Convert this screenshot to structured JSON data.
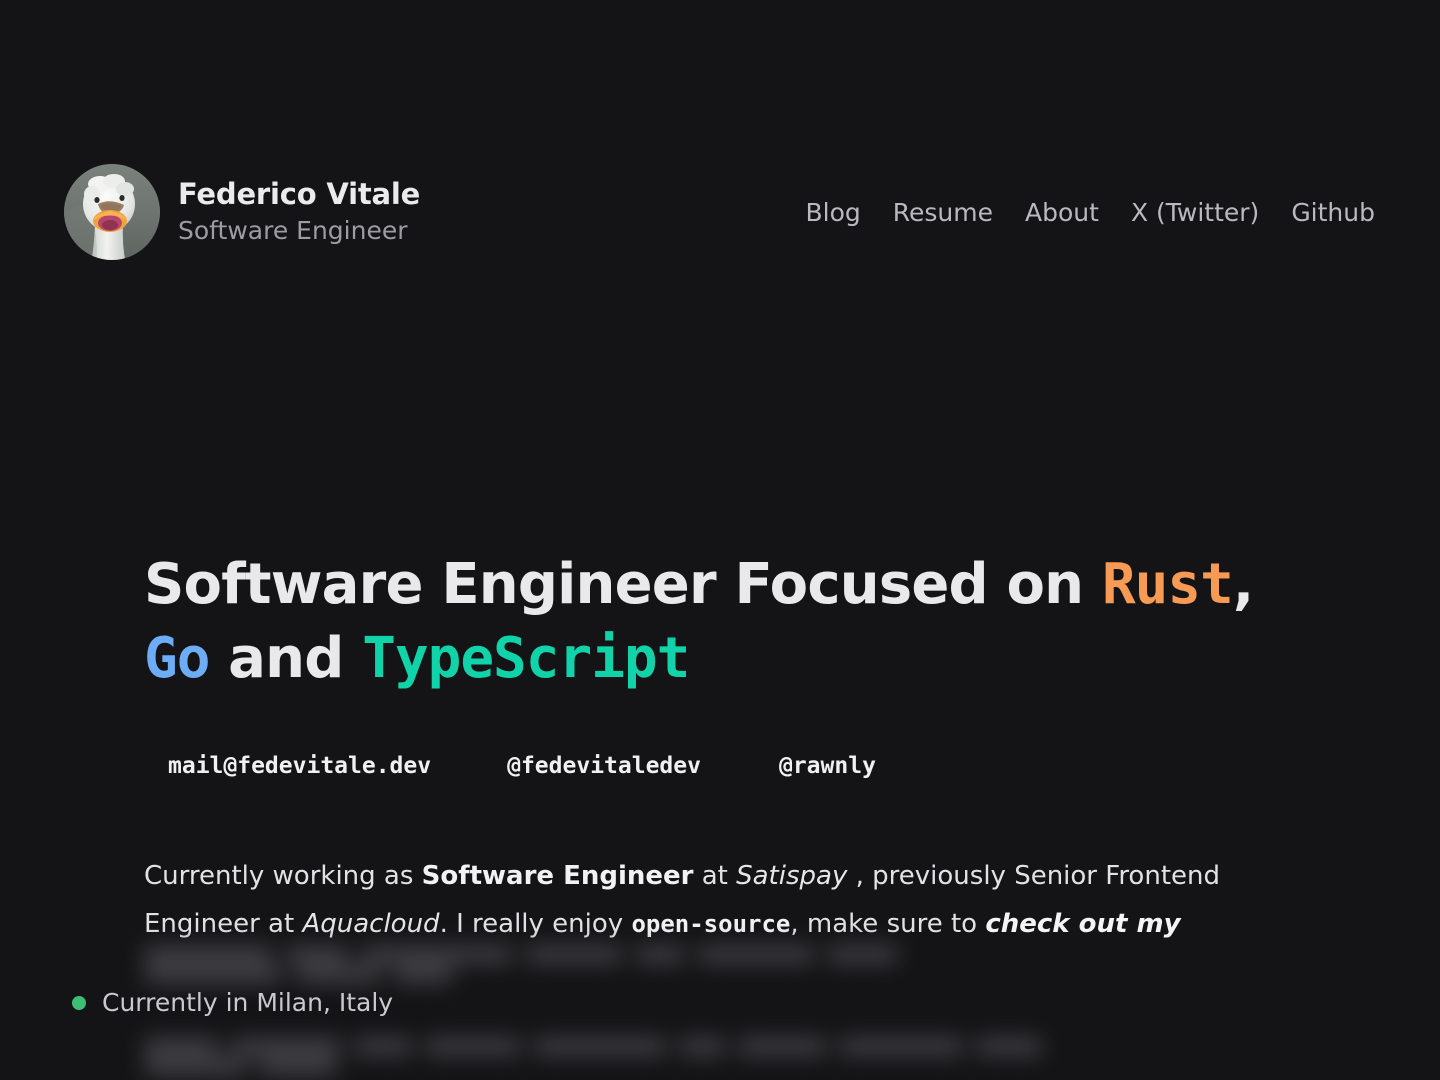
{
  "page": {
    "background_color": "#141416",
    "text_color": "#e9e9eb"
  },
  "header": {
    "avatar": {
      "icon": "goose-avatar",
      "alt": "Goose photo avatar",
      "background_color": "#6e7470"
    },
    "name": "Federico Vitale",
    "role": "Software Engineer",
    "nav": [
      {
        "label": "Blog",
        "name": "nav-link-blog"
      },
      {
        "label": "Resume",
        "name": "nav-link-resume"
      },
      {
        "label": "About",
        "name": "nav-link-about"
      },
      {
        "label": "X (Twitter)",
        "name": "nav-link-x-twitter"
      },
      {
        "label": "Github",
        "name": "nav-link-github"
      }
    ]
  },
  "hero": {
    "title_part_1": "Software Engineer Focused on ",
    "title_rust": "Rust",
    "title_comma": ", ",
    "title_go": "Go",
    "title_and": " and ",
    "title_typescript": "TypeScript",
    "colors": {
      "rust": "#f79a53",
      "go": "#6cadf5",
      "typescript": "#11d3aa"
    }
  },
  "contacts": [
    {
      "label": "mail@fedevitale.dev",
      "name": "contact-email"
    },
    {
      "label": "@fedevitaledev",
      "name": "contact-twitter-handle"
    },
    {
      "label": "@rawnly",
      "name": "contact-github-handle"
    }
  ],
  "bio": {
    "seg_1": "Currently working as ",
    "seg_2_bold": "Software Engineer",
    "seg_3": " at ",
    "seg_4_italic": "Satispay",
    "seg_5": " , previously Senior Frontend Engineer at ",
    "seg_6_italic": "Aquacloud",
    "seg_7": ". I really enjoy ",
    "seg_8_mono": "open-source",
    "seg_9": ", make sure to ",
    "seg_10_bold_italic": "check out my"
  },
  "status": {
    "dot_color": "#3dbd75",
    "label": "Currently in Milan, Italy"
  },
  "blurred_content": {
    "note": "obscured text lines behind status bar",
    "line_1_runs": [
      128,
      62,
      150,
      96,
      48,
      116,
      70,
      138,
      84,
      58
    ],
    "line_2_runs": [
      74,
      110,
      58,
      96,
      132,
      46,
      88,
      124,
      66,
      102,
      78
    ]
  }
}
